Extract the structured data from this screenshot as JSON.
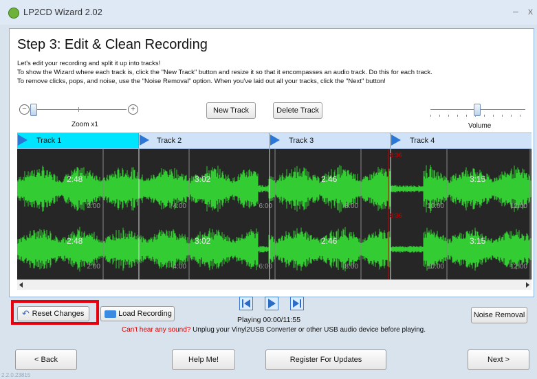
{
  "window": {
    "title": "LP2CD Wizard 2.02",
    "minimize": "–",
    "close": "x"
  },
  "step": {
    "title": "Step 3: Edit & Clean Recording",
    "instructions": [
      "Let's edit your recording and split it up into tracks!",
      "To show the Wizard where each track is, click the \"New Track\" button and resize it so that it encompasses an audio track. Do this for each track.",
      "To remove clicks, pops, and noise, use the \"Noise Removal\" option. When you've laid out all your tracks, click the \"Next\" button!"
    ]
  },
  "zoom": {
    "label": "Zoom x1",
    "minus": "⊖",
    "plus": "⊕"
  },
  "toolbar": {
    "new_track": "New Track",
    "delete_track": "Delete Track"
  },
  "volume": {
    "label": "Volume"
  },
  "tracks": [
    {
      "name": "Track 1",
      "duration": "2:48",
      "selected": true
    },
    {
      "name": "Track 2",
      "duration": "3:02",
      "selected": false
    },
    {
      "name": "Track 3",
      "duration": "2:46",
      "selected": false
    },
    {
      "name": "Track 4",
      "duration": "3:15",
      "selected": false
    }
  ],
  "timeline": {
    "ticks": [
      "2:00",
      "4:00",
      "6:00",
      "8:00",
      "10:00",
      "12:00"
    ],
    "playhead": "8:36"
  },
  "actions": {
    "reset": "Reset Changes",
    "load": "Load Recording",
    "noise": "Noise Removal"
  },
  "transport": {
    "status": "Playing  00:00/11:55"
  },
  "warning": {
    "red": "Can't hear any sound?",
    "text": " Unplug your Vinyl2USB Converter or other USB audio device before playing."
  },
  "nav": {
    "back": "< Back",
    "help": "Help Me!",
    "register": "Register For Updates",
    "next": "Next >"
  },
  "version": "2.2.0.23815",
  "colors": {
    "wave": "#33cc33",
    "selected_track": "#00e5ff",
    "playhead": "#cc0000",
    "highlight": "#e8000d"
  }
}
